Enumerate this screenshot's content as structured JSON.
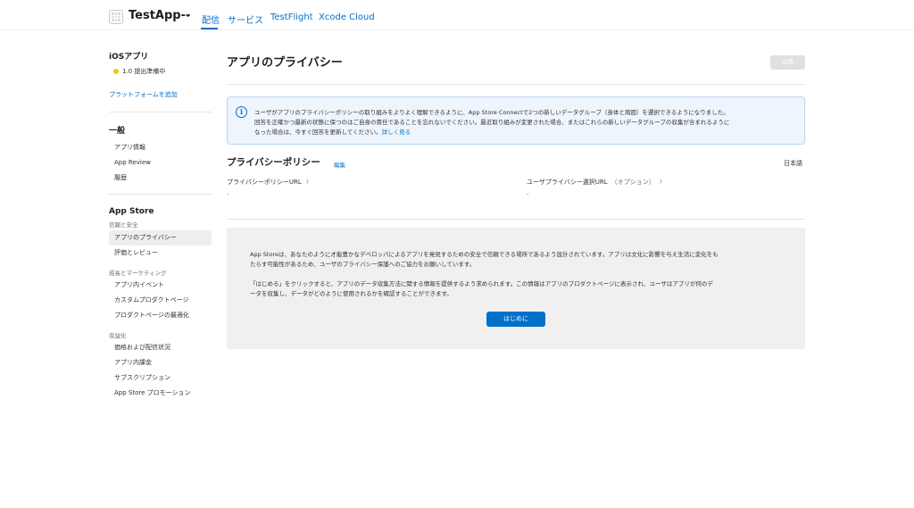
{
  "header": {
    "app_name": "TestApp--",
    "nav": [
      "配信",
      "サービス",
      "TestFlight",
      "Xcode Cloud"
    ]
  },
  "sidebar": {
    "platform_title": "iOSアプリ",
    "version_status": "1.0 提出準備中",
    "add_platform": "プラットフォームを追加",
    "general_title": "一般",
    "general_items": [
      "アプリ情報",
      "App Review",
      "履歴"
    ],
    "appstore_title": "App Store",
    "trust_label": "信頼と安全",
    "trust_items": [
      "アプリのプライバシー",
      "評価とレビュー"
    ],
    "growth_label": "成長とマーケティング",
    "growth_items": [
      "アプリ内イベント",
      "カスタムプロダクトページ",
      "プロダクトページの最適化"
    ],
    "monetize_label": "収益化",
    "monetize_items": [
      "価格および配信状況",
      "アプリ内課金",
      "サブスクリプション",
      "App Store プロモーション"
    ]
  },
  "main": {
    "title": "アプリのプライバシー",
    "publish_button": "公開",
    "info": {
      "line1": "ユーザがアプリのプライバシーポリシーの取り組みをよりよく理解できるように、App Store Connectで2つの新しいデータグループ（身体と周囲）を選択できるようになりました。",
      "line2": "回答を正確かつ最新の状態に保つのはご自身の責任であることを忘れないでください。最近取り組みが変更された場合、またはこれらの新しいデータグループの収集が含まれるように",
      "line3": "なった場合は、今すぐ回答を更新してください。",
      "learn_more": "詳しく見る"
    },
    "privacy_policy": {
      "title": "プライバシーポリシー",
      "edit": "編集",
      "language": "日本語",
      "url_label": "プライバシーポリシーURL",
      "url_value": "-",
      "choice_label": "ユーザプライバシー選択URL",
      "choice_optional": "（オプション）",
      "choice_value": "-",
      "help": "?"
    },
    "intro": {
      "para1_line1": "App Storeは、あなたのように才能豊かなデベロッパによるアプリを発見するための安全で信頼できる場所であるよう設計されています。アプリは文化に影響を与え生活に変化をも",
      "para1_line2": "たらす可能性があるため、ユーザのプライバシー保護へのご協力をお願いしています。",
      "para2_line1": "「はじめる」をクリックすると、アプリのデータ収集方法に関する情報を提供するよう求められます。この情報はアプリのプロダクトページに表示され、ユーザはアプリが何のデ",
      "para2_line2": "ータを収集し、データがどのように使用されるかを確認することができます。",
      "start_button": "はじめに"
    }
  }
}
